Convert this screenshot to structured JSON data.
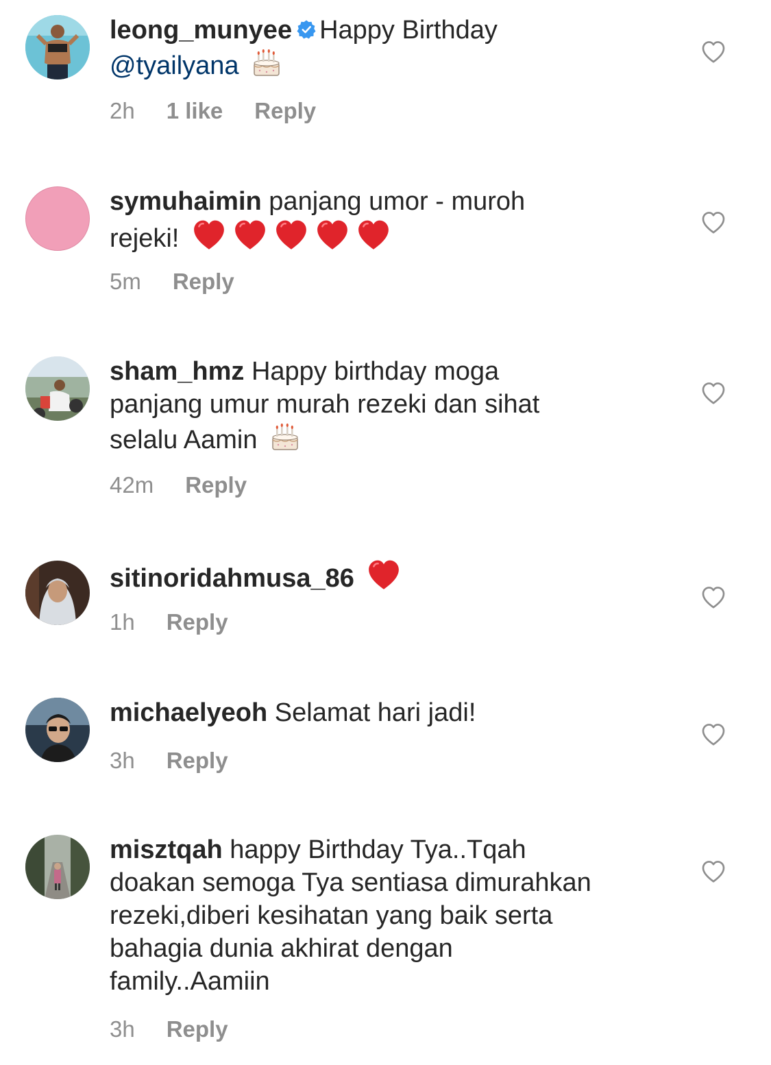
{
  "comments": [
    {
      "username": "leong_munyee",
      "verified": true,
      "text": "Happy Birthday",
      "mention": "@tyailyana",
      "emoji": "🎂",
      "time": "2h",
      "likes": "1 like",
      "reply": "Reply"
    },
    {
      "username": "symuhaimin",
      "text": "panjang umor - muroh",
      "text2": "rejeki!",
      "emoji": "❤️❤️❤️❤️❤️",
      "time": "5m",
      "reply": "Reply"
    },
    {
      "username": "sham_hmz",
      "text": "Happy birthday moga",
      "text2": "panjang umur murah rezeki dan sihat",
      "text3": "selalu Aamin",
      "emoji": "🎂",
      "time": "42m",
      "reply": "Reply"
    },
    {
      "username": "sitinoridahmusa_86",
      "emoji": "❤️",
      "time": "1h",
      "reply": "Reply"
    },
    {
      "username": "michaelyeoh",
      "text": "Selamat hari jadi!",
      "time": "3h",
      "reply": "Reply"
    },
    {
      "username": "misztqah",
      "text": "happy Birthday Tya..Tqah",
      "text2": "doakan semoga Tya sentiasa dimurahkan",
      "text3": "rezeki,diberi kesihatan yang baik serta",
      "text4": "bahagia dunia akhirat dengan",
      "text5": "family..Aamiin",
      "time": "3h",
      "reply": "Reply"
    }
  ],
  "icons": {
    "like": "heart-outline-icon",
    "verified": "verified-badge-icon",
    "cake": "birthday-cake-emoji",
    "heart": "red-heart-emoji"
  },
  "colors": {
    "text": "#262626",
    "meta": "#8e8e8e",
    "mention": "#003569",
    "verified": "#3897f0",
    "heart": "#e0242b"
  }
}
